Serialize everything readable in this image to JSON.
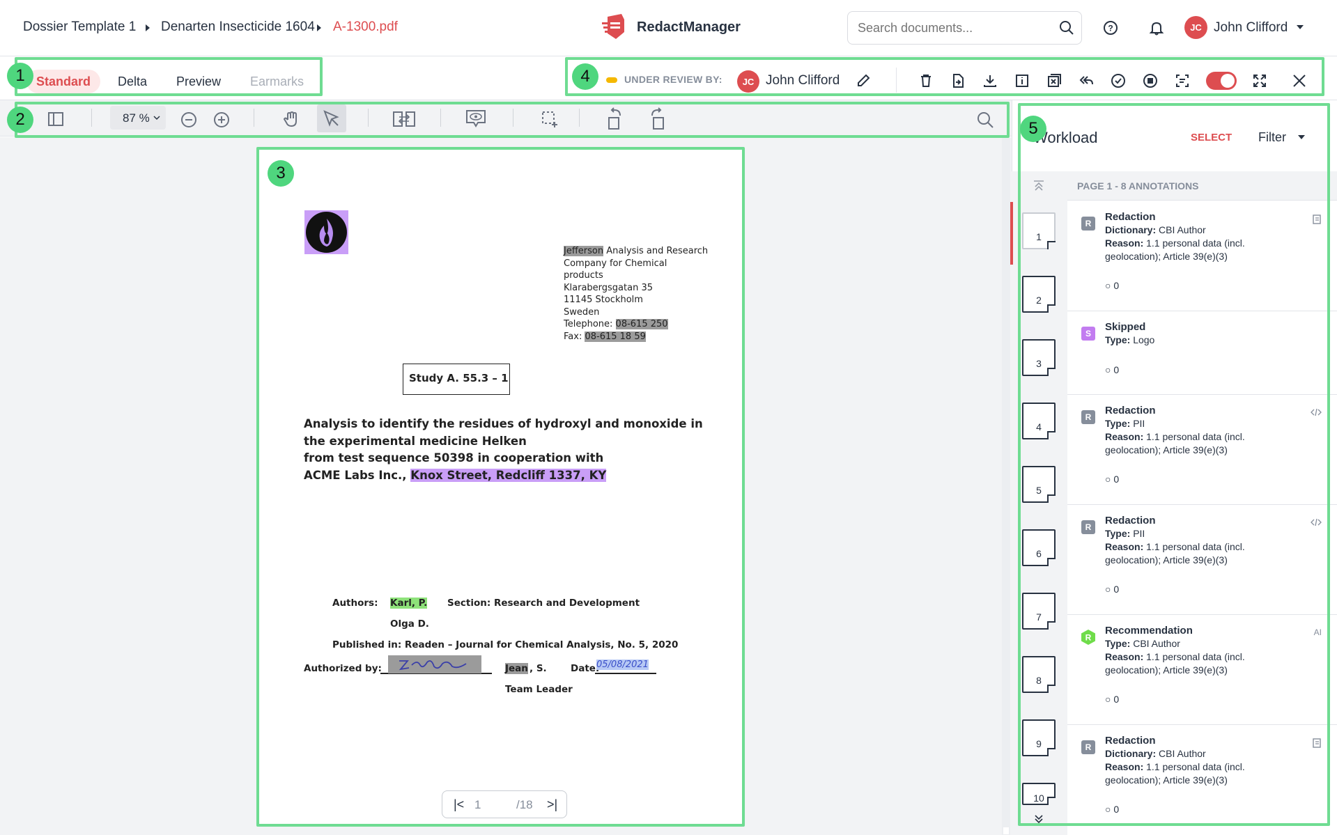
{
  "breadcrumb": {
    "items": [
      "Dossier Template 1",
      "Denarten Insecticide 1604",
      "A-1300.pdf"
    ]
  },
  "brand": {
    "name": "RedactManager",
    "accent": "#dd4d50"
  },
  "search": {
    "placeholder": "Search documents..."
  },
  "user": {
    "initials": "JC",
    "name": "John Clifford"
  },
  "tabs": [
    "Standard",
    "Delta",
    "Preview",
    "Earmarks"
  ],
  "review": {
    "label": "UNDER REVIEW BY:",
    "initials": "JC",
    "name": "John Clifford"
  },
  "zoom": {
    "value": "87 %"
  },
  "badges": [
    "1",
    "2",
    "3",
    "4",
    "5"
  ],
  "document": {
    "company": [
      "Jefferson",
      " Analysis and Research",
      "Company for Chemical",
      "products",
      "Klarabergsgatan 35",
      "11145 Stockholm",
      "Sweden"
    ],
    "telephone_label": "Telephone: ",
    "telephone": "08-615 250",
    "fax_label": "Fax: ",
    "fax": "08-615 18 59",
    "study": "Study A. 55.3 – 1",
    "title": [
      "Analysis to identify the residues of hydroxyl and monoxide in",
      "the experimental medicine Helken",
      "from test sequence 50398 in cooperation with",
      "ACME Labs Inc., "
    ],
    "address": "Knox Street, Redcliff 1337, KY",
    "authors_label": "Authors:",
    "author1": "Karl, P.",
    "section": "Section: Research and Development",
    "author2": "Olga D.",
    "published": "Published in: Readen – Journal for Chemical Analysis, No. 5, 2020",
    "authorized_label": "Authorized by:",
    "signer": "Jean",
    "signer_rest": ", S.",
    "date_label": "Date:",
    "date_value": "05/08/2021",
    "team_leader": "Team Leader"
  },
  "pagination": {
    "current": "1",
    "total": "/18"
  },
  "panel": {
    "title": "Workload",
    "select": "SELECT",
    "filter": "Filter",
    "page_header": "PAGE 1 - 8 ANNOTATIONS"
  },
  "thumbnails": [
    "1",
    "2",
    "3",
    "4",
    "5",
    "6",
    "7",
    "8",
    "9",
    "10"
  ],
  "annotations": [
    {
      "icon": "R",
      "title": "Redaction",
      "l1k": "Dictionary:",
      "l1v": " CBI Author",
      "l2k": "Reason:",
      "l2v": " 1.1 personal data (incl. geolocation); Article 39(e)(3)",
      "comments": "0"
    },
    {
      "icon": "S",
      "title": "Skipped",
      "l1k": "Type:",
      "l1v": " Logo",
      "comments": "0"
    },
    {
      "icon": "R",
      "title": "Redaction",
      "l1k": "Type:",
      "l1v": " PII",
      "l2k": "Reason:",
      "l2v": " 1.1 personal data (incl. geolocation); Article 39(e)(3)",
      "comments": "0"
    },
    {
      "icon": "R",
      "title": "Redaction",
      "l1k": "Type:",
      "l1v": " PII",
      "l2k": "Reason:",
      "l2v": " 1.1 personal data (incl. geolocation); Article 39(e)(3)",
      "comments": "0"
    },
    {
      "icon": "R",
      "title": "Recommendation",
      "l1k": "Type:",
      "l1v": " CBI Author",
      "l2k": "Reason:",
      "l2v": " 1.1 personal data (incl. geolocation); Article 39(e)(3)",
      "comments": "0",
      "corner": "AI"
    },
    {
      "icon": "R",
      "title": "Redaction",
      "l1k": "Dictionary:",
      "l1v": " CBI Author",
      "l2k": "Reason:",
      "l2v": " 1.1 personal data (incl. geolocation); Article 39(e)(3)",
      "comments": "0"
    }
  ]
}
